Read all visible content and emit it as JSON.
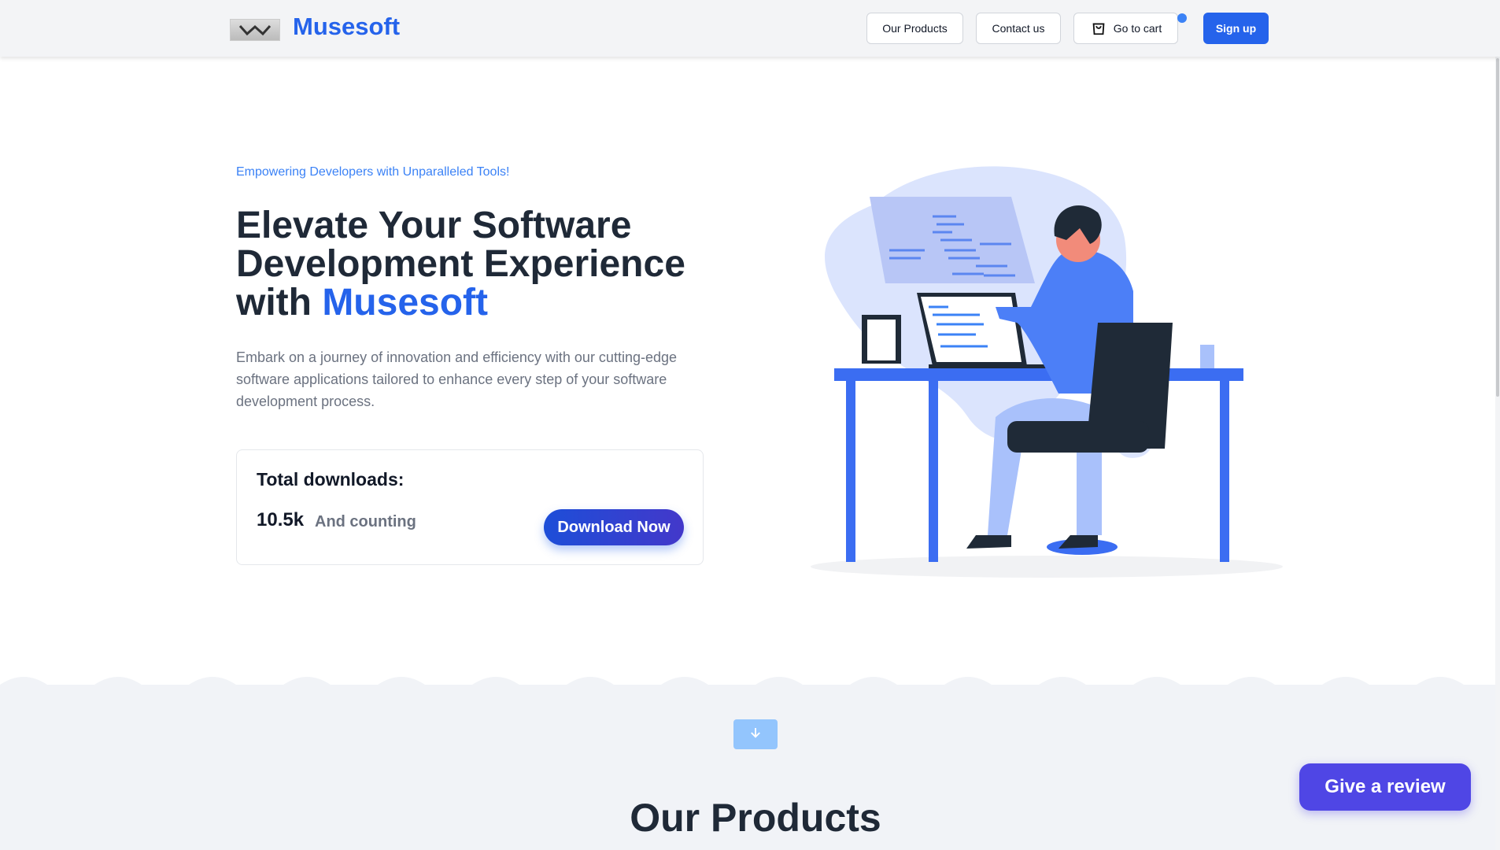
{
  "header": {
    "brand": "Musesoft",
    "nav": {
      "products": "Our Products",
      "contact": "Contact us",
      "cart": "Go to cart",
      "signup": "Sign up"
    }
  },
  "hero": {
    "tagline": "Empowering Developers with Unparalleled Tools!",
    "headline_line1": "Elevate Your Software",
    "headline_line2": "Development Experience",
    "headline_prefix": "with ",
    "headline_accent": "Musesoft",
    "lede": "Embark on a journey of innovation and efficiency with our cutting-edge software applications tailored to enhance every step of your software development process."
  },
  "downloads": {
    "title": "Total downloads:",
    "count": "10.5k",
    "subtitle": "And counting",
    "button": "Download Now"
  },
  "products": {
    "title": "Our Products"
  },
  "review_button": "Give a review",
  "colors": {
    "brand": "#2563eb",
    "review": "#4f46e5",
    "cart_dot": "#3b82f6"
  }
}
